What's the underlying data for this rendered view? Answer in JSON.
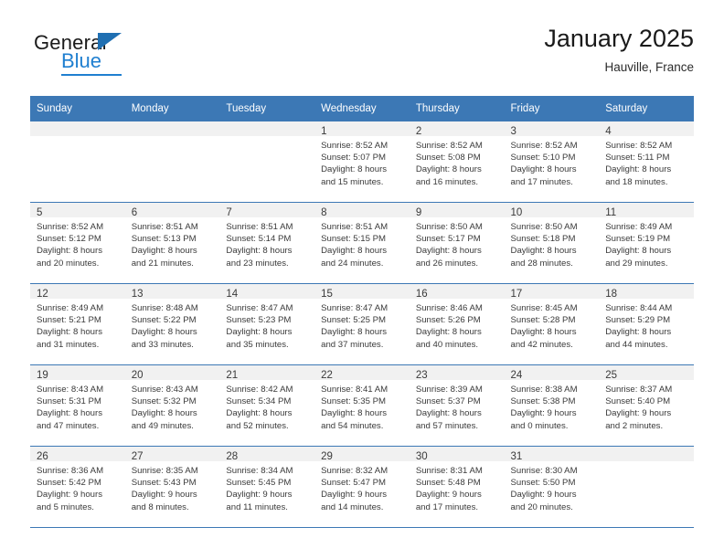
{
  "brand": {
    "name_part1": "General",
    "name_part2": "Blue",
    "triangle_icon": "triangle-icon"
  },
  "header": {
    "title": "January 2025",
    "subtitle": "Hauville, France"
  },
  "colors": {
    "header_blue": "#3c78b5",
    "logo_blue": "#1f7fd0",
    "daynum_band": "#f1f1f1",
    "text": "#3a3a3a"
  },
  "weekdays": [
    "Sunday",
    "Monday",
    "Tuesday",
    "Wednesday",
    "Thursday",
    "Friday",
    "Saturday"
  ],
  "weeks": [
    [
      {
        "day": "",
        "sunrise": "",
        "sunset": "",
        "daylight1": "",
        "daylight2": ""
      },
      {
        "day": "",
        "sunrise": "",
        "sunset": "",
        "daylight1": "",
        "daylight2": ""
      },
      {
        "day": "",
        "sunrise": "",
        "sunset": "",
        "daylight1": "",
        "daylight2": ""
      },
      {
        "day": "1",
        "sunrise": "Sunrise: 8:52 AM",
        "sunset": "Sunset: 5:07 PM",
        "daylight1": "Daylight: 8 hours",
        "daylight2": "and 15 minutes."
      },
      {
        "day": "2",
        "sunrise": "Sunrise: 8:52 AM",
        "sunset": "Sunset: 5:08 PM",
        "daylight1": "Daylight: 8 hours",
        "daylight2": "and 16 minutes."
      },
      {
        "day": "3",
        "sunrise": "Sunrise: 8:52 AM",
        "sunset": "Sunset: 5:10 PM",
        "daylight1": "Daylight: 8 hours",
        "daylight2": "and 17 minutes."
      },
      {
        "day": "4",
        "sunrise": "Sunrise: 8:52 AM",
        "sunset": "Sunset: 5:11 PM",
        "daylight1": "Daylight: 8 hours",
        "daylight2": "and 18 minutes."
      }
    ],
    [
      {
        "day": "5",
        "sunrise": "Sunrise: 8:52 AM",
        "sunset": "Sunset: 5:12 PM",
        "daylight1": "Daylight: 8 hours",
        "daylight2": "and 20 minutes."
      },
      {
        "day": "6",
        "sunrise": "Sunrise: 8:51 AM",
        "sunset": "Sunset: 5:13 PM",
        "daylight1": "Daylight: 8 hours",
        "daylight2": "and 21 minutes."
      },
      {
        "day": "7",
        "sunrise": "Sunrise: 8:51 AM",
        "sunset": "Sunset: 5:14 PM",
        "daylight1": "Daylight: 8 hours",
        "daylight2": "and 23 minutes."
      },
      {
        "day": "8",
        "sunrise": "Sunrise: 8:51 AM",
        "sunset": "Sunset: 5:15 PM",
        "daylight1": "Daylight: 8 hours",
        "daylight2": "and 24 minutes."
      },
      {
        "day": "9",
        "sunrise": "Sunrise: 8:50 AM",
        "sunset": "Sunset: 5:17 PM",
        "daylight1": "Daylight: 8 hours",
        "daylight2": "and 26 minutes."
      },
      {
        "day": "10",
        "sunrise": "Sunrise: 8:50 AM",
        "sunset": "Sunset: 5:18 PM",
        "daylight1": "Daylight: 8 hours",
        "daylight2": "and 28 minutes."
      },
      {
        "day": "11",
        "sunrise": "Sunrise: 8:49 AM",
        "sunset": "Sunset: 5:19 PM",
        "daylight1": "Daylight: 8 hours",
        "daylight2": "and 29 minutes."
      }
    ],
    [
      {
        "day": "12",
        "sunrise": "Sunrise: 8:49 AM",
        "sunset": "Sunset: 5:21 PM",
        "daylight1": "Daylight: 8 hours",
        "daylight2": "and 31 minutes."
      },
      {
        "day": "13",
        "sunrise": "Sunrise: 8:48 AM",
        "sunset": "Sunset: 5:22 PM",
        "daylight1": "Daylight: 8 hours",
        "daylight2": "and 33 minutes."
      },
      {
        "day": "14",
        "sunrise": "Sunrise: 8:47 AM",
        "sunset": "Sunset: 5:23 PM",
        "daylight1": "Daylight: 8 hours",
        "daylight2": "and 35 minutes."
      },
      {
        "day": "15",
        "sunrise": "Sunrise: 8:47 AM",
        "sunset": "Sunset: 5:25 PM",
        "daylight1": "Daylight: 8 hours",
        "daylight2": "and 37 minutes."
      },
      {
        "day": "16",
        "sunrise": "Sunrise: 8:46 AM",
        "sunset": "Sunset: 5:26 PM",
        "daylight1": "Daylight: 8 hours",
        "daylight2": "and 40 minutes."
      },
      {
        "day": "17",
        "sunrise": "Sunrise: 8:45 AM",
        "sunset": "Sunset: 5:28 PM",
        "daylight1": "Daylight: 8 hours",
        "daylight2": "and 42 minutes."
      },
      {
        "day": "18",
        "sunrise": "Sunrise: 8:44 AM",
        "sunset": "Sunset: 5:29 PM",
        "daylight1": "Daylight: 8 hours",
        "daylight2": "and 44 minutes."
      }
    ],
    [
      {
        "day": "19",
        "sunrise": "Sunrise: 8:43 AM",
        "sunset": "Sunset: 5:31 PM",
        "daylight1": "Daylight: 8 hours",
        "daylight2": "and 47 minutes."
      },
      {
        "day": "20",
        "sunrise": "Sunrise: 8:43 AM",
        "sunset": "Sunset: 5:32 PM",
        "daylight1": "Daylight: 8 hours",
        "daylight2": "and 49 minutes."
      },
      {
        "day": "21",
        "sunrise": "Sunrise: 8:42 AM",
        "sunset": "Sunset: 5:34 PM",
        "daylight1": "Daylight: 8 hours",
        "daylight2": "and 52 minutes."
      },
      {
        "day": "22",
        "sunrise": "Sunrise: 8:41 AM",
        "sunset": "Sunset: 5:35 PM",
        "daylight1": "Daylight: 8 hours",
        "daylight2": "and 54 minutes."
      },
      {
        "day": "23",
        "sunrise": "Sunrise: 8:39 AM",
        "sunset": "Sunset: 5:37 PM",
        "daylight1": "Daylight: 8 hours",
        "daylight2": "and 57 minutes."
      },
      {
        "day": "24",
        "sunrise": "Sunrise: 8:38 AM",
        "sunset": "Sunset: 5:38 PM",
        "daylight1": "Daylight: 9 hours",
        "daylight2": "and 0 minutes."
      },
      {
        "day": "25",
        "sunrise": "Sunrise: 8:37 AM",
        "sunset": "Sunset: 5:40 PM",
        "daylight1": "Daylight: 9 hours",
        "daylight2": "and 2 minutes."
      }
    ],
    [
      {
        "day": "26",
        "sunrise": "Sunrise: 8:36 AM",
        "sunset": "Sunset: 5:42 PM",
        "daylight1": "Daylight: 9 hours",
        "daylight2": "and 5 minutes."
      },
      {
        "day": "27",
        "sunrise": "Sunrise: 8:35 AM",
        "sunset": "Sunset: 5:43 PM",
        "daylight1": "Daylight: 9 hours",
        "daylight2": "and 8 minutes."
      },
      {
        "day": "28",
        "sunrise": "Sunrise: 8:34 AM",
        "sunset": "Sunset: 5:45 PM",
        "daylight1": "Daylight: 9 hours",
        "daylight2": "and 11 minutes."
      },
      {
        "day": "29",
        "sunrise": "Sunrise: 8:32 AM",
        "sunset": "Sunset: 5:47 PM",
        "daylight1": "Daylight: 9 hours",
        "daylight2": "and 14 minutes."
      },
      {
        "day": "30",
        "sunrise": "Sunrise: 8:31 AM",
        "sunset": "Sunset: 5:48 PM",
        "daylight1": "Daylight: 9 hours",
        "daylight2": "and 17 minutes."
      },
      {
        "day": "31",
        "sunrise": "Sunrise: 8:30 AM",
        "sunset": "Sunset: 5:50 PM",
        "daylight1": "Daylight: 9 hours",
        "daylight2": "and 20 minutes."
      },
      {
        "day": "",
        "sunrise": "",
        "sunset": "",
        "daylight1": "",
        "daylight2": ""
      }
    ]
  ]
}
